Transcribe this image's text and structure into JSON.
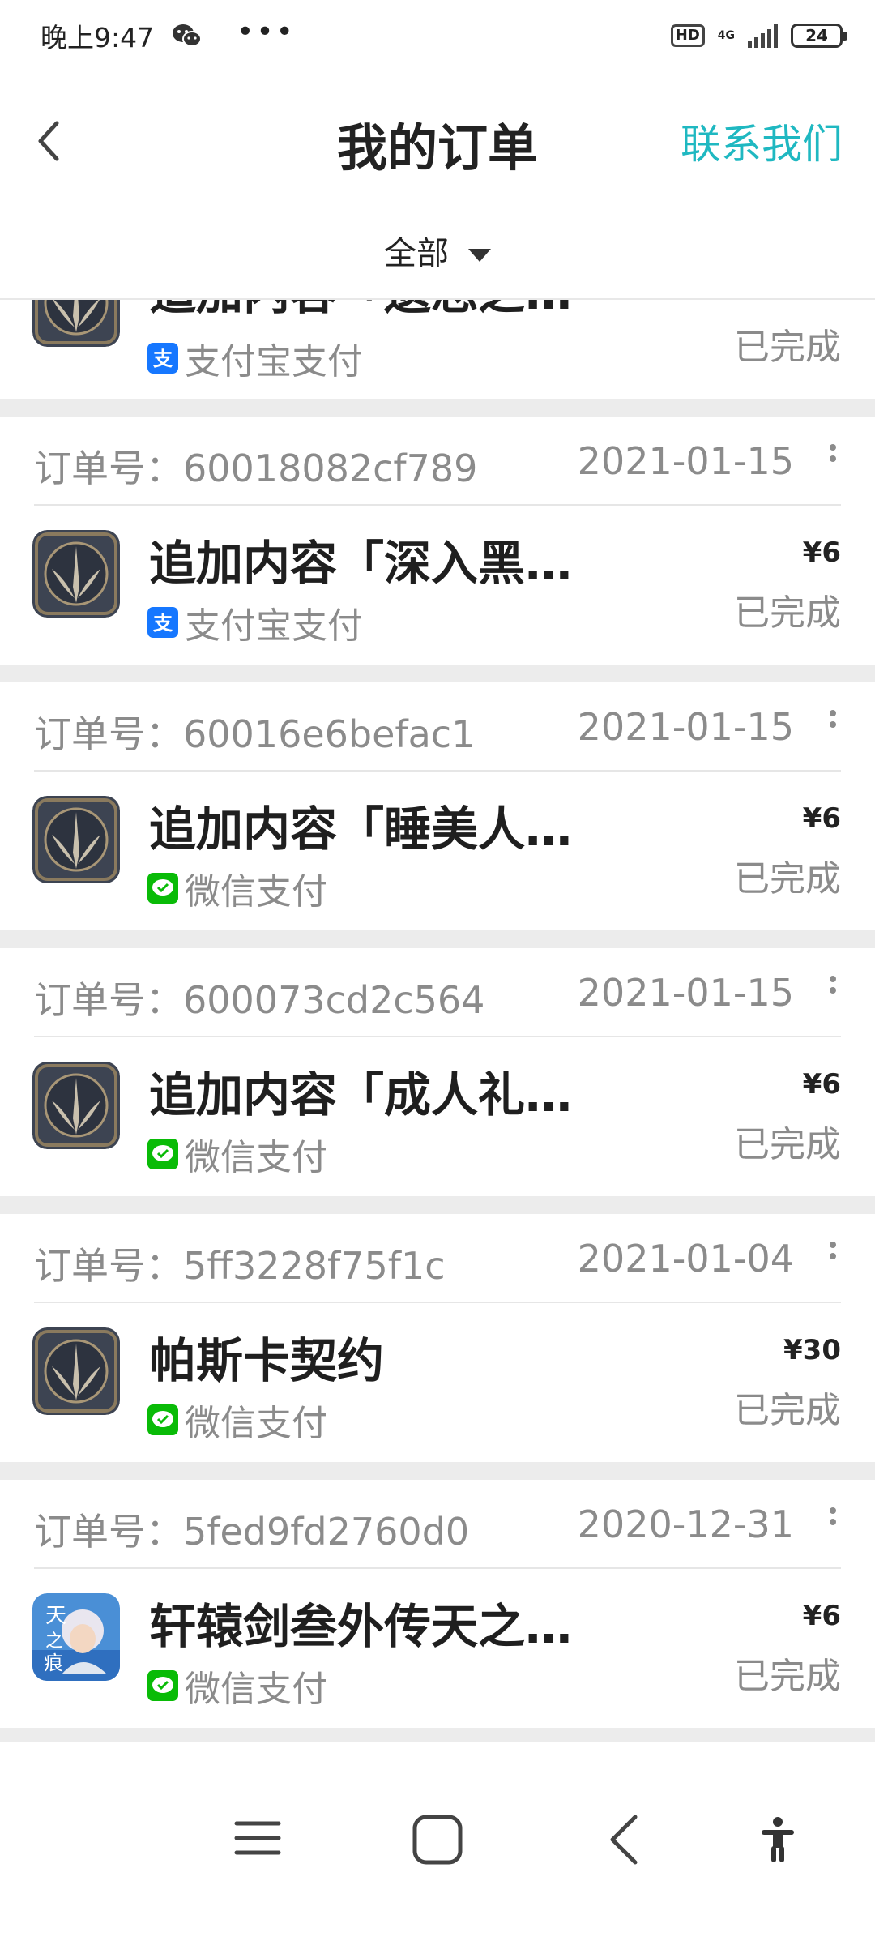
{
  "status_bar": {
    "time": "晚上9:47",
    "hd": "HD",
    "network": "4G",
    "battery": "24",
    "icons": [
      "wechat-icon",
      "more-dots-icon",
      "signal-icon",
      "battery-icon"
    ]
  },
  "header": {
    "title": "我的订单",
    "contact": "联系我们"
  },
  "filter": {
    "label": "全部"
  },
  "partial_card": {
    "item_name": "追加内容「遗忘之…",
    "pay_method": "支付宝支付",
    "status": "已完成"
  },
  "orders": [
    {
      "order_no": "订单号：60018082cf789",
      "date": "2021-01-15",
      "item_name": "追加内容「深入黑…",
      "pay_method": "支付宝支付",
      "pay_type": "alipay",
      "price": "¥6",
      "status": "已完成",
      "icon": "game-emblem-icon"
    },
    {
      "order_no": "订单号：60016e6befac1",
      "date": "2021-01-15",
      "item_name": "追加内容「睡美人…",
      "pay_method": "微信支付",
      "pay_type": "wechat",
      "price": "¥6",
      "status": "已完成",
      "icon": "game-emblem-icon"
    },
    {
      "order_no": "订单号：600073cd2c564",
      "date": "2021-01-15",
      "item_name": "追加内容「成人礼…",
      "pay_method": "微信支付",
      "pay_type": "wechat",
      "price": "¥6",
      "status": "已完成",
      "icon": "game-emblem-icon"
    },
    {
      "order_no": "订单号：5ff3228f75f1c",
      "date": "2021-01-04",
      "item_name": "帕斯卡契约",
      "pay_method": "微信支付",
      "pay_type": "wechat",
      "price": "¥30",
      "status": "已完成",
      "icon": "game-emblem-icon"
    },
    {
      "order_no": "订单号：5fed9fd2760d0",
      "date": "2020-12-31",
      "item_name": "轩辕剑叁外传天之…",
      "pay_method": "微信支付",
      "pay_type": "wechat",
      "price": "¥6",
      "status": "已完成",
      "icon": "game-portrait-icon"
    }
  ],
  "colors": {
    "accent": "#1fb8c1",
    "alipay": "#1677ff",
    "wechat": "#09bb07",
    "separator": "#ececec"
  }
}
